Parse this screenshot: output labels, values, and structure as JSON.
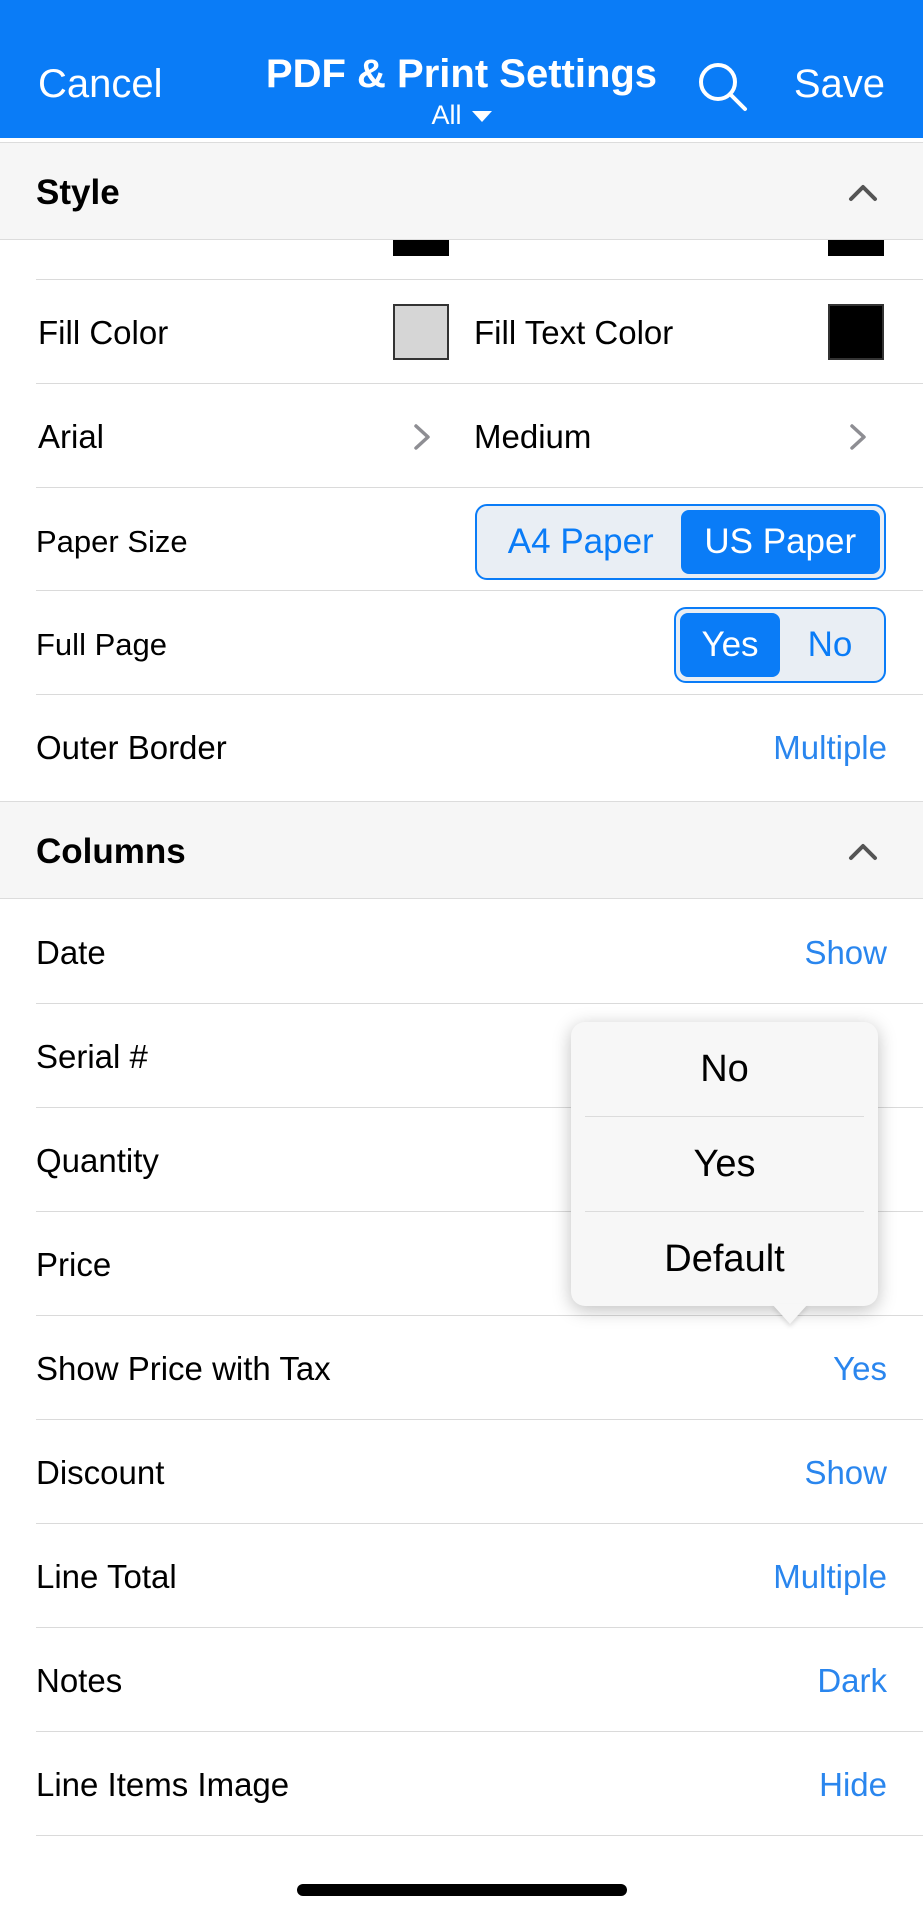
{
  "navbar": {
    "cancel_label": "Cancel",
    "title": "PDF & Print Settings",
    "subtitle": "All",
    "save_label": "Save"
  },
  "style_section": {
    "title": "Style",
    "fill_color_label": "Fill Color",
    "fill_color": "#d6d6d6",
    "fill_text_color_label": "Fill Text Color",
    "fill_text_color": "#000000",
    "font_name": "Arial",
    "font_size": "Medium",
    "paper_size_label": "Paper Size",
    "paper_options": [
      "A4 Paper",
      "US Paper"
    ],
    "paper_selected": "US Paper",
    "full_page_label": "Full Page",
    "full_page_options": [
      "Yes",
      "No"
    ],
    "full_page_selected": "Yes",
    "outer_border_label": "Outer Border",
    "outer_border_value": "Multiple"
  },
  "columns_section": {
    "title": "Columns",
    "rows": [
      {
        "label": "Date",
        "value": "Show"
      },
      {
        "label": "Serial #",
        "value": ""
      },
      {
        "label": "Quantity",
        "value": ""
      },
      {
        "label": "Price",
        "value": ""
      },
      {
        "label": "Show Price with Tax",
        "value": "Yes"
      },
      {
        "label": "Discount",
        "value": "Show"
      },
      {
        "label": "Line Total",
        "value": "Multiple"
      },
      {
        "label": "Notes",
        "value": "Dark"
      },
      {
        "label": "Line Items Image",
        "value": "Hide"
      }
    ]
  },
  "popover": {
    "options": [
      "No",
      "Yes",
      "Default"
    ]
  },
  "colors": {
    "accent": "#0a7cf7",
    "value_text": "#2a86ee"
  }
}
